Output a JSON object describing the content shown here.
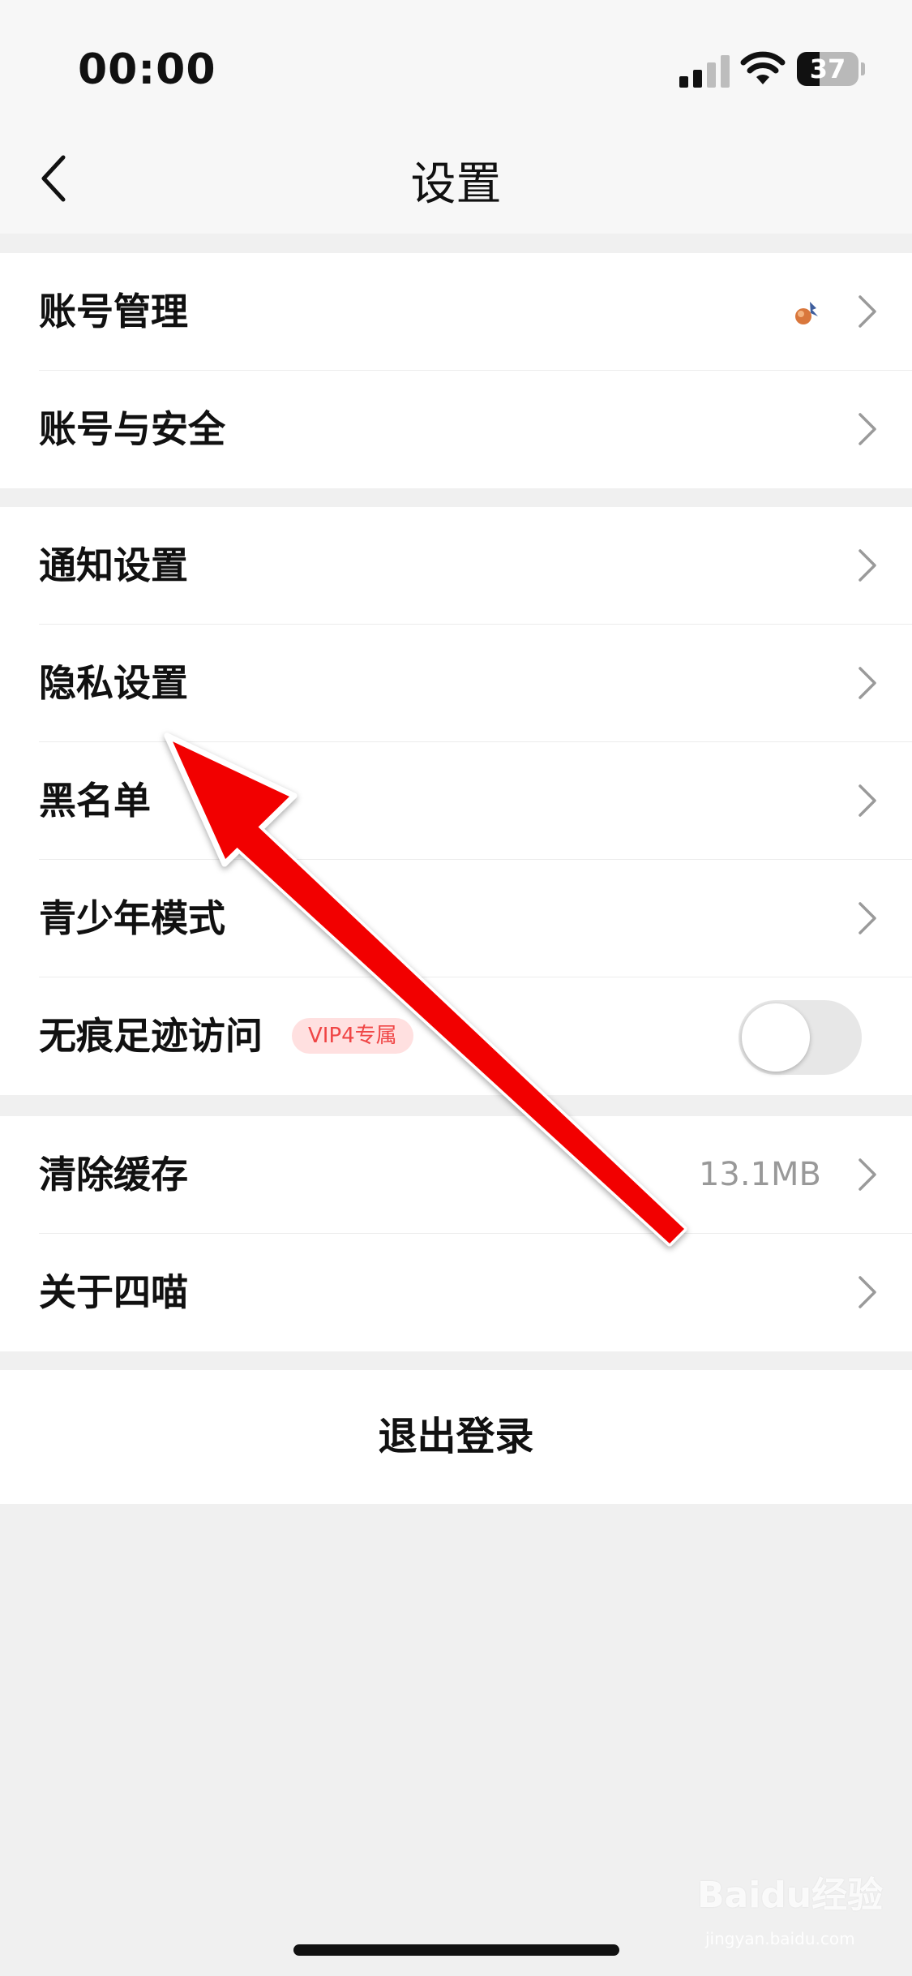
{
  "status_bar": {
    "time": "00:00",
    "battery_level": "37",
    "battery_fill": 0.37,
    "icons": [
      "signal-icon",
      "wifi-icon",
      "battery-icon"
    ]
  },
  "nav": {
    "title": "设置",
    "back_icon": "chevron-left-icon"
  },
  "groups": [
    {
      "items": [
        {
          "label": "账号管理",
          "accessory": "avatar + chevron-right-icon"
        },
        {
          "label": "账号与安全",
          "accessory": "chevron-right-icon"
        }
      ]
    },
    {
      "items": [
        {
          "label": "通知设置"
        },
        {
          "label": "隐私设置"
        },
        {
          "label": "黑名单"
        },
        {
          "label": "青少年模式"
        },
        {
          "label": "无痕足迹访问",
          "badge": "VIP4专属",
          "toggle": false
        }
      ]
    },
    {
      "items": [
        {
          "label": "清除缓存",
          "value": "13.1MB"
        },
        {
          "label": "关于四喵"
        }
      ]
    }
  ],
  "logout": {
    "label": "退出登录"
  },
  "annotation": {
    "arrow_color": "#f20000",
    "points_to": "隐私设置"
  },
  "watermark": {
    "text": "Baidu经验",
    "sub": "jingyan.baidu.com"
  },
  "colors": {
    "background": "#f0f0f0",
    "card": "#ffffff",
    "badge_bg": "#ffe0e0",
    "badge_text": "#f04545",
    "secondary_text": "#999999"
  }
}
